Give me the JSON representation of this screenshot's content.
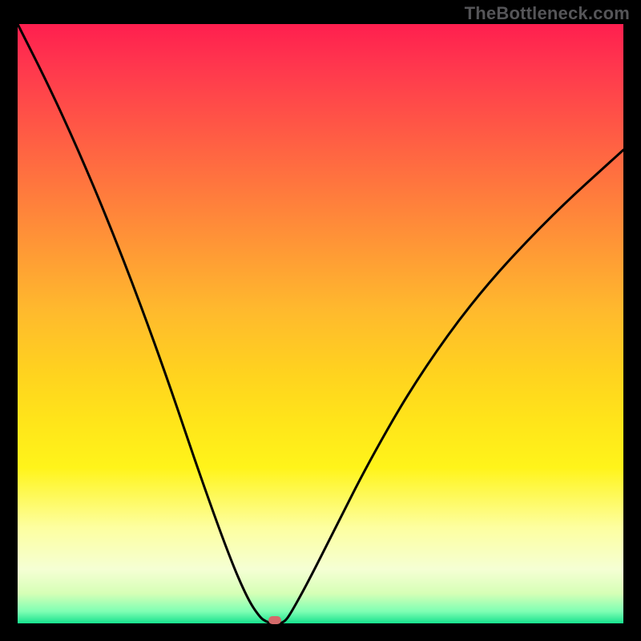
{
  "watermark": "TheBottleneck.com",
  "colors": {
    "page_bg": "#000000",
    "curve_stroke": "#000000",
    "marker_fill": "#d46a6a",
    "watermark_text": "#555558"
  },
  "chart_data": {
    "type": "line",
    "title": "",
    "xlabel": "",
    "ylabel": "",
    "xlim": [
      0,
      100
    ],
    "ylim": [
      0,
      100
    ],
    "grid": false,
    "legend": false,
    "series": [
      {
        "name": "bottleneck-curve",
        "x": [
          0,
          5,
          10,
          15,
          20,
          25,
          30,
          35,
          38,
          40,
          41,
          42,
          43,
          44,
          45,
          48,
          52,
          58,
          66,
          76,
          88,
          100
        ],
        "y": [
          100,
          90,
          79,
          67,
          54,
          40,
          25,
          11,
          4,
          1,
          0.3,
          0,
          0,
          0.2,
          1.5,
          7,
          15,
          27,
          41,
          55,
          68,
          79
        ]
      }
    ],
    "marker": {
      "x": 42.5,
      "y": 0
    },
    "gradient_stops": [
      {
        "pct": 0,
        "color": "#ff1f4f"
      },
      {
        "pct": 18,
        "color": "#ff5a45"
      },
      {
        "pct": 38,
        "color": "#ff9a35"
      },
      {
        "pct": 58,
        "color": "#ffd21f"
      },
      {
        "pct": 74,
        "color": "#fff41a"
      },
      {
        "pct": 91,
        "color": "#f5ffd4"
      },
      {
        "pct": 100,
        "color": "#16e18d"
      }
    ]
  }
}
